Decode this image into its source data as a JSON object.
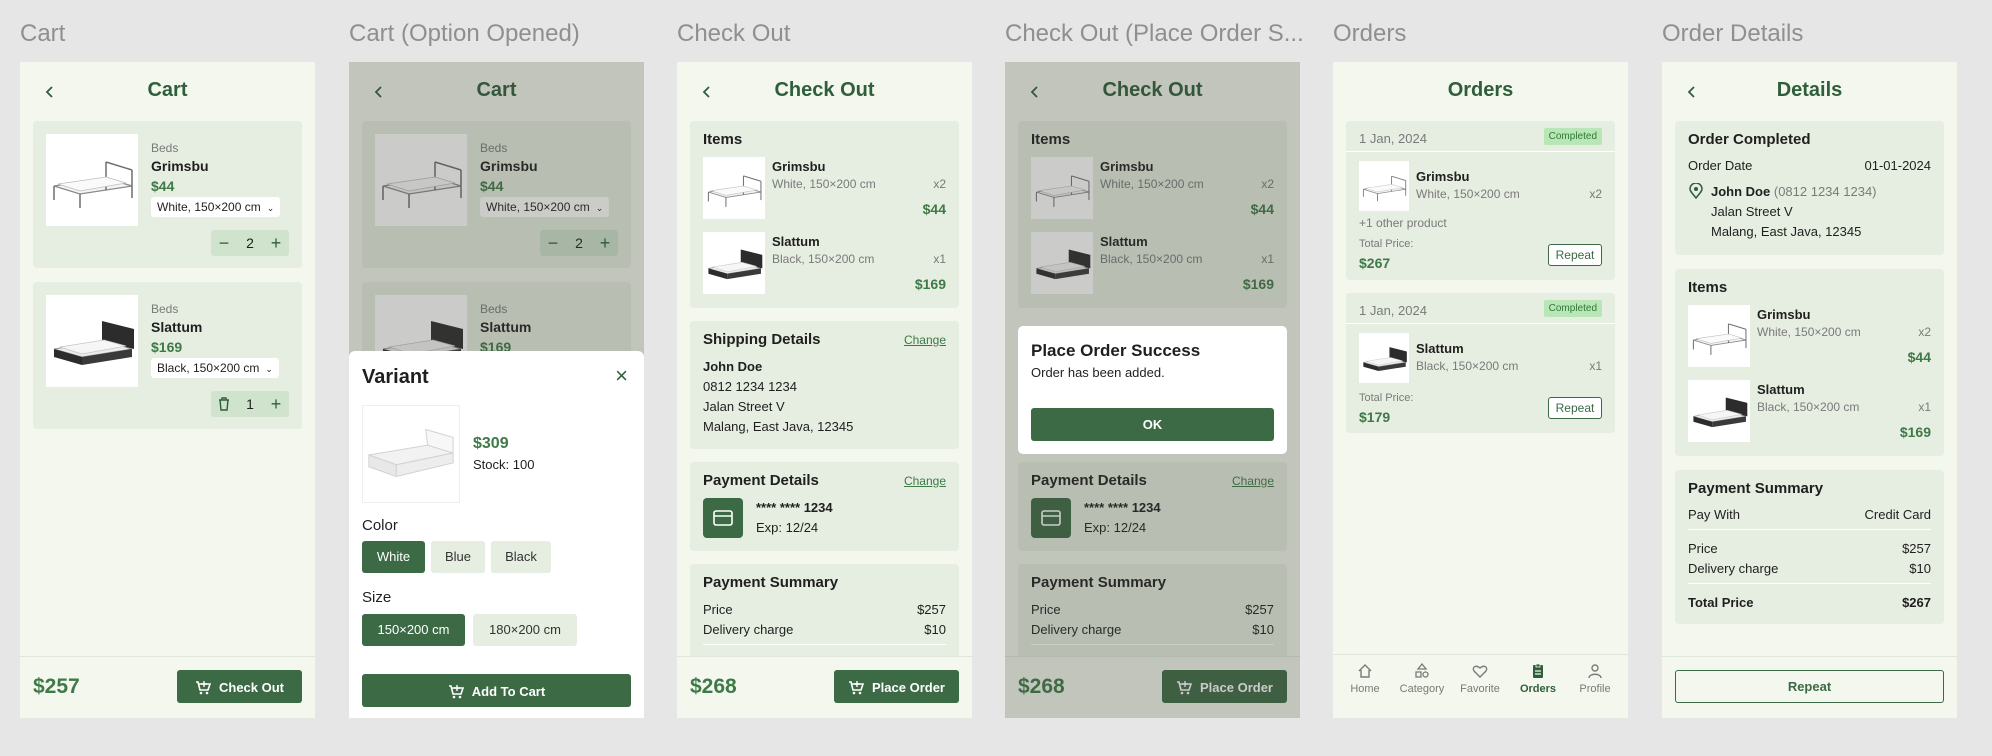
{
  "frames": {
    "f1": "Cart",
    "f2": "Cart (Option Opened)",
    "f3": "Check Out",
    "f4": "Check Out (Place Order S...",
    "f5": "Orders",
    "f6": "Order Details"
  },
  "colors": {
    "accent": "#3c6a44",
    "price": "#3e7a47",
    "bg": "#f3f7ee",
    "card": "#e6ede1",
    "badge": "#b8e6b7"
  },
  "cart": {
    "title": "Cart",
    "items": [
      {
        "category": "Beds",
        "name": "Grimsbu",
        "price": "$44",
        "variant": "White, 150×200 cm",
        "qty": "2"
      },
      {
        "category": "Beds",
        "name": "Slattum",
        "price": "$169",
        "variant": "Black, 150×200 cm",
        "qty": "1"
      }
    ],
    "total": "$257",
    "checkout_label": "Check Out"
  },
  "cart_option": {
    "title": "Cart",
    "variant_title": "Variant",
    "price": "$309",
    "stock": "Stock: 100",
    "color_label": "Color",
    "colors": [
      "White",
      "Blue",
      "Black"
    ],
    "size_label": "Size",
    "sizes": [
      "150×200 cm",
      "180×200 cm"
    ],
    "add_label": "Add To Cart"
  },
  "checkout": {
    "title": "Check Out",
    "items_label": "Items",
    "items": [
      {
        "name": "Grimsbu",
        "variant": "White, 150×200 cm",
        "qty": "x2",
        "price": "$44"
      },
      {
        "name": "Slattum",
        "variant": "Black, 150×200 cm",
        "qty": "x1",
        "price": "$169"
      }
    ],
    "shipping_label": "Shipping Details",
    "change_label": "Change",
    "ship_name": "John Doe",
    "ship_phone": "0812 1234 1234",
    "ship_street": "Jalan Street V",
    "ship_city": "Malang, East Java, 12345",
    "payment_label": "Payment Details",
    "card_number": "**** **** 1234",
    "card_exp": "Exp: 12/24",
    "summary_label": "Payment Summary",
    "price_label": "Price",
    "price_value": "$257",
    "delivery_label": "Delivery charge",
    "delivery_value": "$10",
    "total": "$268",
    "place_label": "Place Order"
  },
  "dialog": {
    "title": "Place Order Success",
    "message": "Order has been added.",
    "ok": "OK"
  },
  "orders": {
    "title": "Orders",
    "list": [
      {
        "date": "1 Jan, 2024",
        "status": "Completed",
        "name": "Grimsbu",
        "variant": "White, 150×200 cm",
        "qty": "x2",
        "other": "+1 other product",
        "total_label": "Total Price:",
        "total": "$267",
        "repeat": "Repeat"
      },
      {
        "date": "1 Jan, 2024",
        "status": "Completed",
        "name": "Slattum",
        "variant": "Black, 150×200 cm",
        "qty": "x1",
        "other": "",
        "total_label": "Total Price:",
        "total": "$179",
        "repeat": "Repeat"
      }
    ],
    "nav": [
      "Home",
      "Category",
      "Favorite",
      "Orders",
      "Profile"
    ]
  },
  "details": {
    "title": "Details",
    "completed": "Order Completed",
    "date_label": "Order Date",
    "date_value": "01-01-2024",
    "name": "John Doe",
    "phone": "(0812 1234 1234)",
    "street": "Jalan Street V",
    "city": "Malang, East Java, 12345",
    "items_label": "Items",
    "items": [
      {
        "name": "Grimsbu",
        "variant": "White, 150×200 cm",
        "qty": "x2",
        "price": "$44"
      },
      {
        "name": "Slattum",
        "variant": "Black, 150×200 cm",
        "qty": "x1",
        "price": "$169"
      }
    ],
    "summary_label": "Payment Summary",
    "pay_with_label": "Pay With",
    "pay_with_value": "Credit Card",
    "price_label": "Price",
    "price_value": "$257",
    "delivery_label": "Delivery charge",
    "delivery_value": "$10",
    "total_label": "Total Price",
    "total_value": "$267",
    "repeat": "Repeat"
  }
}
